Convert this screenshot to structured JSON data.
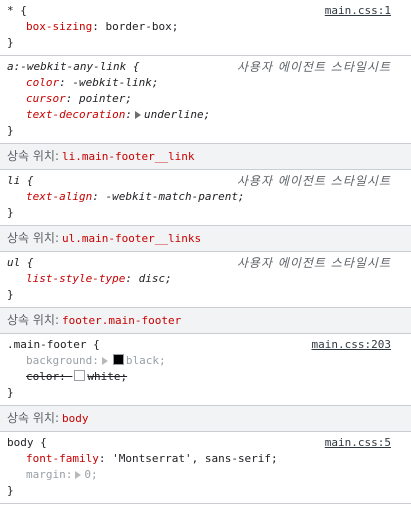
{
  "rules": [
    {
      "selector": "* {",
      "source": "main.css:1",
      "decls": [
        {
          "prop": "box-sizing",
          "val": "border-box;"
        }
      ]
    },
    {
      "selector": "a:-webkit-any-link {",
      "ua": "사용자 에이전트 스타일시트",
      "decls": [
        {
          "prop": "color",
          "val": "-webkit-link;"
        },
        {
          "prop": "cursor",
          "val": "pointer;"
        },
        {
          "prop": "text-decoration",
          "val": "underline;"
        }
      ]
    }
  ],
  "inherit_label": "상속 위치:",
  "inherit1": "li.main-footer__link",
  "li_rule": {
    "selector": "li {",
    "ua": "사용자 에이전트 스타일시트",
    "prop": "text-align",
    "val": "-webkit-match-parent;"
  },
  "inherit2": "ul.main-footer__links",
  "ul_rule": {
    "selector": "ul {",
    "ua": "사용자 에이전트 스타일시트",
    "prop": "list-style-type",
    "val": "disc;"
  },
  "inherit3": "footer.main-footer",
  "footer_rule": {
    "selector": ".main-footer {",
    "source": "main.css:203",
    "bg_prop": "background",
    "bg_val": "black;",
    "bg_color": "#000000",
    "color_prop": "color",
    "color_val": "white;",
    "color_swatch": "#ffffff"
  },
  "inherit4": "body",
  "body_rule": {
    "selector": "body {",
    "source": "main.css:5",
    "ff_prop": "font-family",
    "ff_val": "'Montserrat', sans-serif;",
    "m_prop": "margin",
    "m_val": "0;"
  },
  "close_brace": "}"
}
